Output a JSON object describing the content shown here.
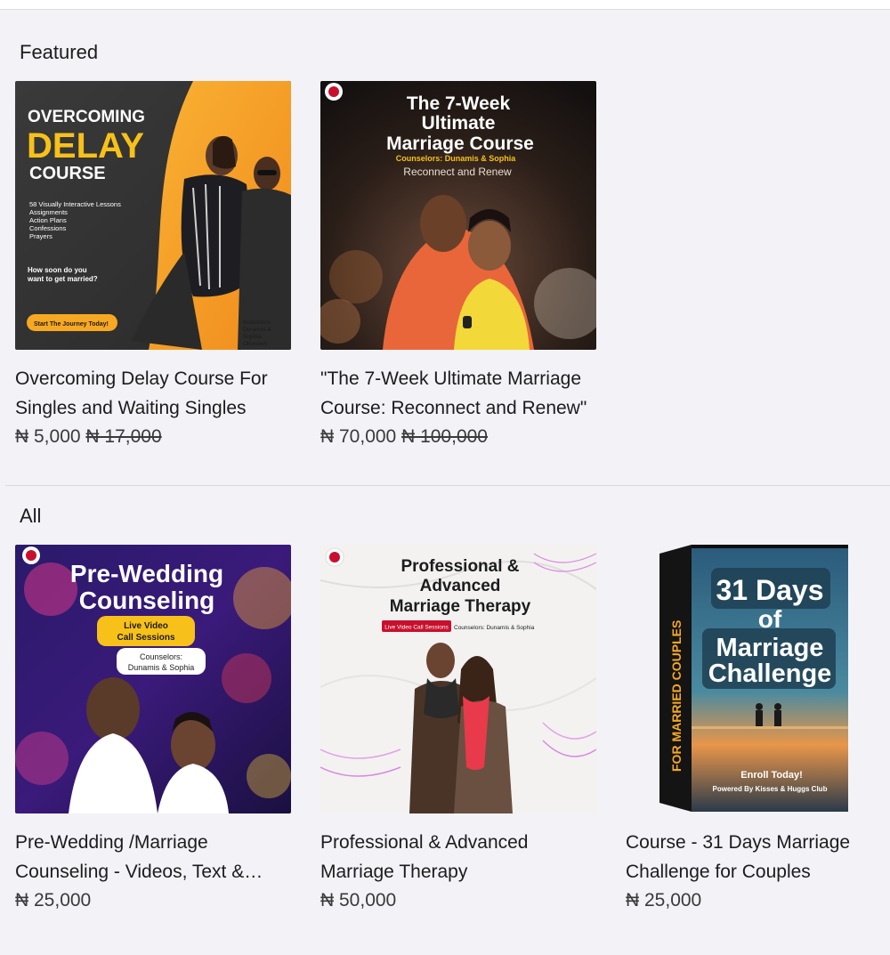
{
  "sections": {
    "featured": {
      "title": "Featured",
      "products": [
        {
          "title": "Overcoming Delay Course For Singles and Waiting Singles",
          "price": "₦ 5,000",
          "old_price": "₦ 17,000",
          "image": {
            "line1": "OVERCOMING",
            "line2": "DELAY",
            "line3": "COURSE",
            "features": [
              "58 Visually Interactive Lessons",
              "Assignments",
              "Action Plans",
              "Confessions",
              "Prayers"
            ],
            "question1": "How soon do you",
            "question2": "want to get married?",
            "cta": "Start The Journey Today!",
            "instructors": [
              "Instructors:",
              "Dunamis &",
              "Sophia",
              "Okunowo"
            ]
          }
        },
        {
          "title": "\"The 7-Week Ultimate Marriage Course: Reconnect and Renew\"",
          "price": "₦ 70,000",
          "old_price": "₦ 100,000",
          "image": {
            "line1": "The 7-Week",
            "line2": "Ultimate",
            "line3": "Marriage Course",
            "counselors": "Counselors: Dunamis & Sophia",
            "tagline": "Reconnect and Renew"
          }
        }
      ]
    },
    "all": {
      "title": "All",
      "products": [
        {
          "title": "Pre-Wedding /Marriage Counseling - Videos, Text & Audio",
          "price": "₦ 25,000",
          "image": {
            "line1": "Pre-Wedding",
            "line2": "Counseling",
            "bubble1_line1": "Live Video",
            "bubble1_line2": "Call Sessions",
            "bubble2_line1": "Counselors:",
            "bubble2_line2": "Dunamis & Sophia"
          }
        },
        {
          "title": "Professional & Advanced Marriage Therapy",
          "price": "₦ 50,000",
          "image": {
            "line1": "Professional &",
            "line2": "Advanced",
            "line3": "Marriage Therapy",
            "badge": "Live Video Call Sessions",
            "counselors": "Counselors: Dunamis & Sophia"
          }
        },
        {
          "title": "Course - 31 Days Marriage Challenge for Couples",
          "price": "₦ 25,000",
          "image": {
            "line1": "31 Days",
            "line2": "of",
            "line3": "Marriage",
            "line4": "Challenge",
            "spine": "FOR MARRIED COUPLES",
            "enroll": "Enroll Today!",
            "powered": "Powered By Kisses & Huggs Club"
          }
        }
      ]
    }
  },
  "colors": {
    "background": "#f2f2f7",
    "text": "#1c1c1e",
    "price_text": "#3a3a3c",
    "accent_yellow": "#f7a823",
    "accent_red": "#c8102e"
  }
}
